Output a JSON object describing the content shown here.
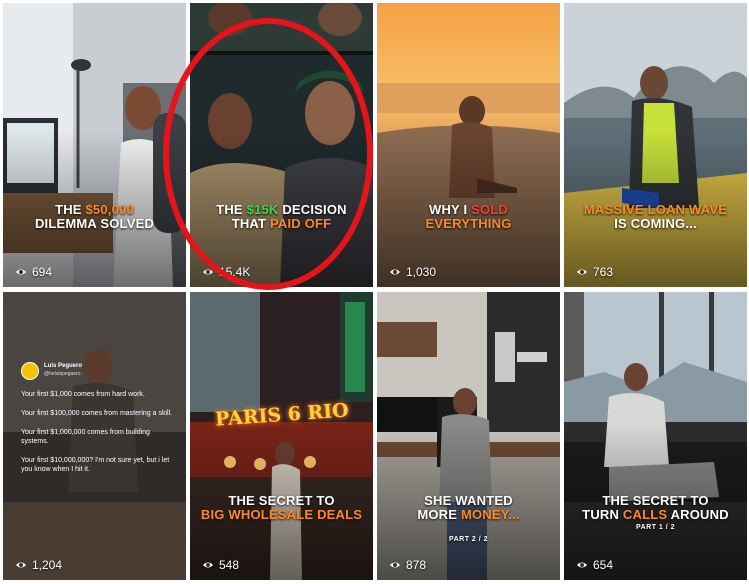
{
  "colors": {
    "accent_orange": "#ff8a1f",
    "accent_green": "#38d93f",
    "accent_red": "#ff3b2f",
    "ring": "#e5141b"
  },
  "tiles": [
    {
      "line1_pre": "THE ",
      "line1_hl": "$50,000",
      "line1_post": "",
      "line2_pre": "DILEMMA SOLVED",
      "line2_hl": "",
      "line2_post": "",
      "views": "694"
    },
    {
      "line1_pre": "THE ",
      "line1_hl": "$15K",
      "line1_post": " DECISION",
      "line2_pre": "THAT ",
      "line2_hl": "PAID OFF",
      "line2_post": "",
      "views": "15.4K"
    },
    {
      "line1_pre": "WHY I ",
      "line1_hl": "SOLD",
      "line1_post": "",
      "line2_pre": "",
      "line2_hl": "EVERYTHING",
      "line2_post": "",
      "views": "1,030"
    },
    {
      "line1_pre": "",
      "line1_hl": "MASSIVE LOAN WAVE",
      "line1_post": "",
      "line2_pre": "IS COMING...",
      "line2_hl": "",
      "line2_post": "",
      "views": "763"
    },
    {
      "views": "1,204",
      "tweet": {
        "name": "Luis Peguero",
        "handle": "@heluispeguero",
        "lines": [
          "Your first $1,000 comes from hard work.",
          "Your first $100,000 comes from mastering a skill.",
          "Your first $1,000,000 comes from building systems.",
          "Your first $10,000,000? I'm not sure yet, but i let you know when I hit it."
        ]
      }
    },
    {
      "line1_pre": "THE SECRET TO",
      "line1_hl": "",
      "line1_post": "",
      "line2_pre": "",
      "line2_hl": "BIG WHOLESALE DEALS",
      "line2_post": "",
      "views": "548",
      "sign": "PARIS 6 RIO"
    },
    {
      "line1_pre": "SHE WANTED",
      "line1_hl": "",
      "line1_post": "",
      "line2_pre": "MORE ",
      "line2_hl": "MONEY...",
      "line2_post": "",
      "sub": "PART 2 / 2",
      "views": "878"
    },
    {
      "line1_pre": "THE SECRET TO",
      "line1_hl": "",
      "line1_post": "",
      "line2_pre": "TURN ",
      "line2_hl": "CALLS",
      "line2_post": " AROUND",
      "sub": "PART 1 / 2",
      "views": "654"
    }
  ]
}
